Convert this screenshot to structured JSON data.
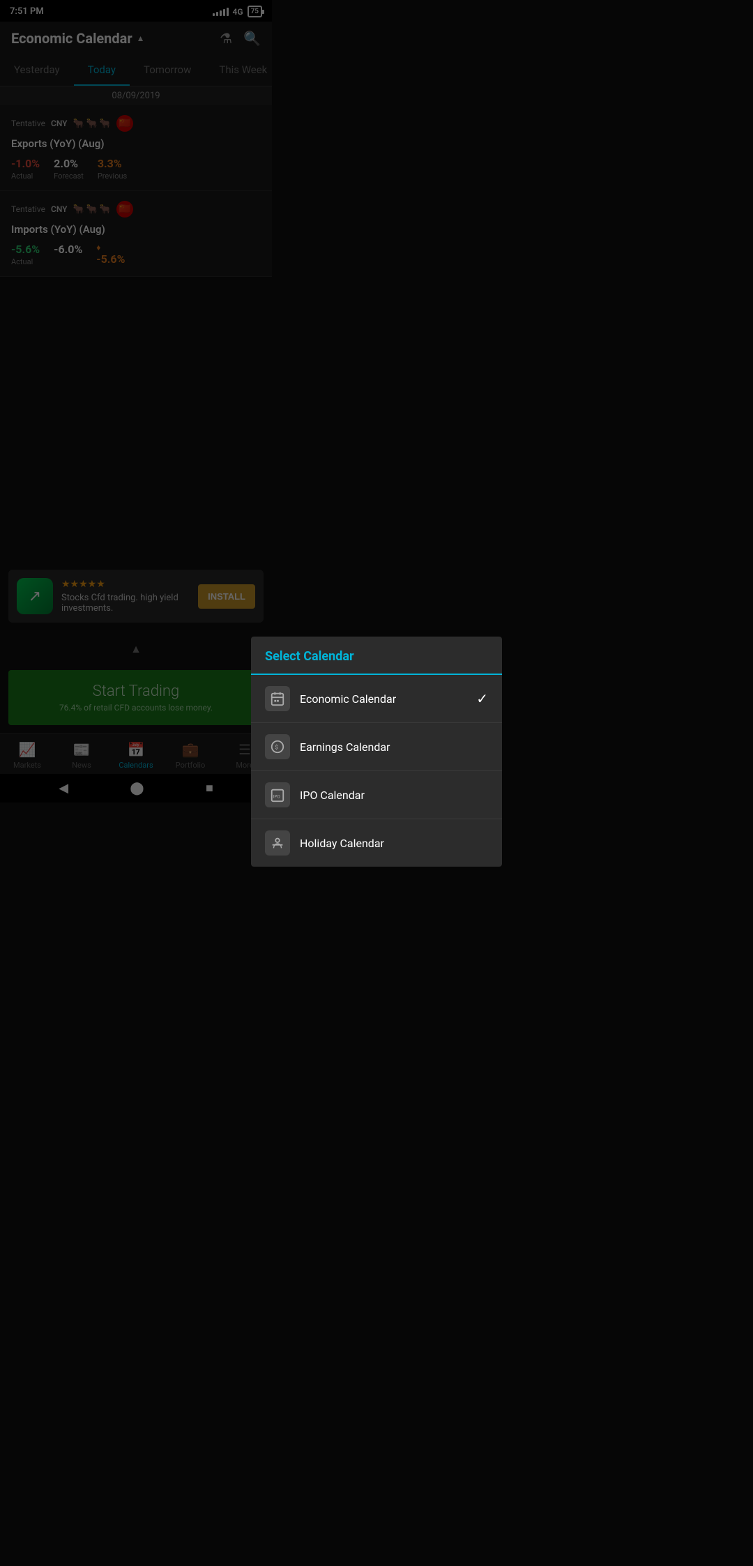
{
  "statusBar": {
    "time": "7:51 PM",
    "network": "4G",
    "battery": "75"
  },
  "header": {
    "title": "Economic Calendar",
    "dropdownArrow": "▲",
    "filterIcon": "⊿",
    "searchIcon": "🔍"
  },
  "tabs": [
    {
      "id": "yesterday",
      "label": "Yesterday",
      "active": false
    },
    {
      "id": "today",
      "label": "Today",
      "active": true
    },
    {
      "id": "tomorrow",
      "label": "Tomorrow",
      "active": false
    },
    {
      "id": "thisweek",
      "label": "This Week",
      "active": false
    }
  ],
  "dateHeader": "08/09/2019",
  "calendarItems": [
    {
      "id": "exports",
      "timing": "Tentative",
      "currency": "CNY",
      "impact": "medium",
      "title": "Exports (YoY) (Aug)",
      "actual": "-1.0%",
      "actualColor": "red",
      "forecast": "2.0%",
      "forecastColor": "white",
      "previous": "3.3%",
      "previousColor": "orange",
      "hasPreviousMarker": false
    },
    {
      "id": "imports",
      "timing": "Tentative",
      "currency": "CNY",
      "impact": "medium",
      "title": "Imports (YoY) (Aug)",
      "actual": "-5.6%",
      "actualColor": "green",
      "forecast": "-6.0%",
      "forecastColor": "white",
      "previous": "-5.6%",
      "previousColor": "orange",
      "hasPreviousMarker": true
    }
  ],
  "modal": {
    "title": "Select Calendar",
    "items": [
      {
        "id": "economic",
        "label": "Economic Calendar",
        "icon": "📅",
        "selected": true
      },
      {
        "id": "earnings",
        "label": "Earnings Calendar",
        "icon": "💰",
        "selected": false
      },
      {
        "id": "ipo",
        "label": "IPO Calendar",
        "icon": "📋",
        "selected": false
      },
      {
        "id": "holiday",
        "label": "Holiday Calendar",
        "icon": "🏖",
        "selected": false
      }
    ]
  },
  "ad": {
    "logoIcon": "↗",
    "stars": "★★★★★",
    "text": "Stocks Cfd trading. high yield investments.",
    "installLabel": "INSTALL"
  },
  "startTrading": {
    "title": "Start Trading",
    "subtitle": "76.4% of retail CFD accounts lose money."
  },
  "bottomNav": [
    {
      "id": "markets",
      "label": "Markets",
      "icon": "📈",
      "active": false
    },
    {
      "id": "news",
      "label": "News",
      "icon": "📰",
      "active": false
    },
    {
      "id": "calendars",
      "label": "Calendars",
      "icon": "📅",
      "active": true
    },
    {
      "id": "portfolio",
      "label": "Portfolio",
      "icon": "💼",
      "active": false
    },
    {
      "id": "more",
      "label": "More",
      "icon": "☰",
      "active": false
    }
  ],
  "androidNav": {
    "back": "◀",
    "home": "⬤",
    "recent": "■"
  }
}
